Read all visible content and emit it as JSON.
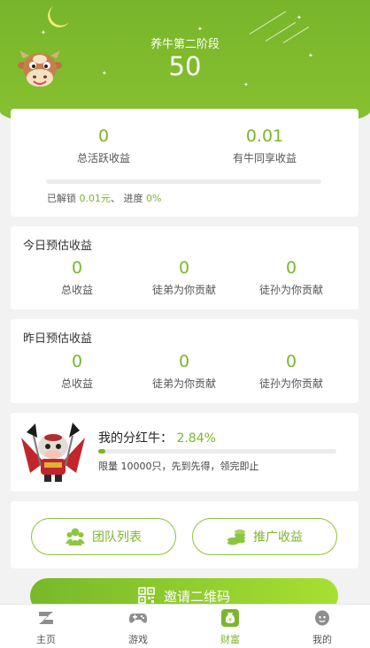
{
  "header": {
    "stage_label": "养牛第二阶段",
    "stage_value": "50"
  },
  "summary": {
    "total_active_income": {
      "value": "0",
      "label": "总活跃收益"
    },
    "shared_income": {
      "value": "0.01",
      "label": "有牛同享收益"
    },
    "progress": 0,
    "unlocked_prefix": "已解锁",
    "unlocked_amount": "0.01元",
    "progress_prefix": "、 进度",
    "progress_value": "0%"
  },
  "today": {
    "title": "今日预估收益",
    "stats": [
      {
        "value": "0",
        "label": "总收益"
      },
      {
        "value": "0",
        "label": "徒弟为你贡献"
      },
      {
        "value": "0",
        "label": "徒孙为你贡献"
      }
    ]
  },
  "yesterday": {
    "title": "昨日预估收益",
    "stats": [
      {
        "value": "0",
        "label": "总收益"
      },
      {
        "value": "0",
        "label": "徒弟为你贡献"
      },
      {
        "value": "0",
        "label": "徒孙为你贡献"
      }
    ]
  },
  "bonus": {
    "title": "我的分红牛：",
    "percent": "2.84%",
    "progress": 0.0284,
    "note": "限量 10000只，先到先得，领完即止"
  },
  "actions": {
    "team_list": "团队列表",
    "promo_income": "推广收益",
    "invite_qr": "邀请二维码"
  },
  "tabs": [
    {
      "label": "主页",
      "icon": "home-icon"
    },
    {
      "label": "游戏",
      "icon": "gamepad-icon"
    },
    {
      "label": "财富",
      "icon": "wallet-icon",
      "active": true
    },
    {
      "label": "我的",
      "icon": "profile-icon"
    }
  ],
  "colors": {
    "accent": "#7bb62b",
    "header_bg": "#7fbb2d",
    "inactive_icon": "#8e8e8e"
  }
}
